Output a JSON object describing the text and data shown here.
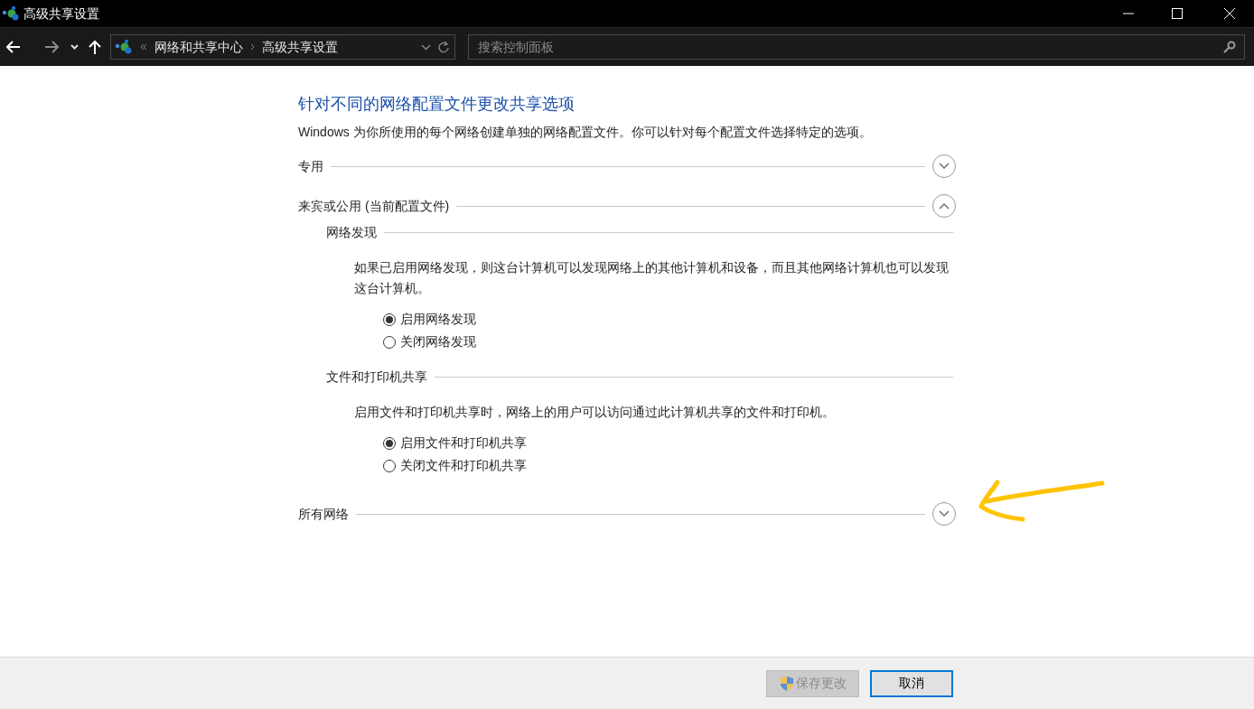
{
  "window": {
    "title": "高级共享设置"
  },
  "address_bar": {
    "path": [
      "网络和共享中心",
      "高级共享设置"
    ]
  },
  "search": {
    "placeholder": "搜索控制面板"
  },
  "heading": "针对不同的网络配置文件更改共享选项",
  "description": "Windows 为你所使用的每个网络创建单独的网络配置文件。你可以针对每个配置文件选择特定的选项。",
  "sections": [
    {
      "label": "专用",
      "expanded": false
    },
    {
      "label": "来宾或公用 (当前配置文件)",
      "expanded": true,
      "groups": [
        {
          "title": "网络发现",
          "description": "如果已启用网络发现，则这台计算机可以发现网络上的其他计算机和设备，而且其他网络计算机也可以发现这台计算机。",
          "options": [
            {
              "label": "启用网络发现",
              "selected": true
            },
            {
              "label": "关闭网络发现",
              "selected": false
            }
          ]
        },
        {
          "title": "文件和打印机共享",
          "description": "启用文件和打印机共享时，网络上的用户可以访问通过此计算机共享的文件和打印机。",
          "options": [
            {
              "label": "启用文件和打印机共享",
              "selected": true
            },
            {
              "label": "关闭文件和打印机共享",
              "selected": false
            }
          ]
        }
      ]
    },
    {
      "label": "所有网络",
      "expanded": false
    }
  ],
  "buttons": [
    {
      "label": "保存更改",
      "kind": "shield",
      "disabled": true,
      "focused": false
    },
    {
      "label": "取消",
      "kind": "plain",
      "disabled": false,
      "focused": true
    }
  ]
}
